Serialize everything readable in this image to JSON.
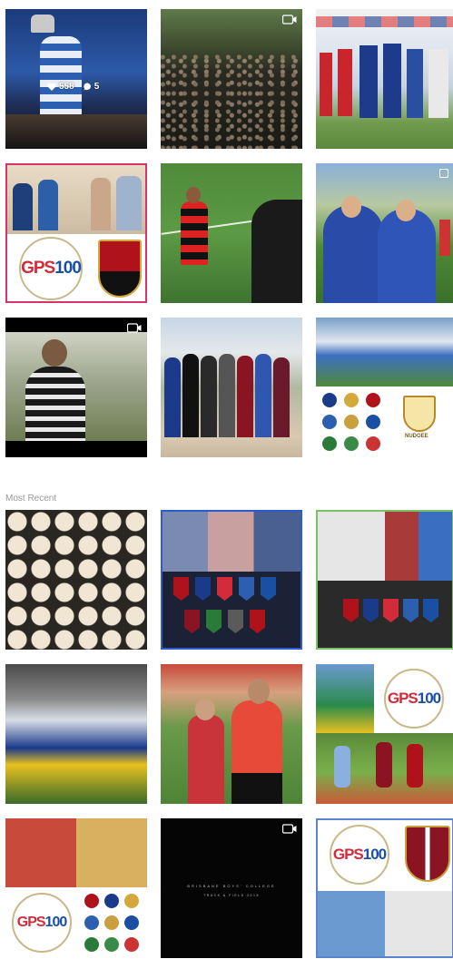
{
  "top_posts": [
    {
      "video": false,
      "stats": {
        "likes": "558",
        "comments": "5"
      }
    },
    {
      "video": true
    },
    {
      "video": false
    },
    {
      "video": false,
      "gps_text": "GPS100"
    },
    {
      "video": false
    },
    {
      "video": false
    },
    {
      "video": true
    },
    {
      "video": false
    },
    {
      "video": false,
      "nudgee_text": "NUDGEE"
    }
  ],
  "section": {
    "most_recent_label": "Most Recent"
  },
  "recent_posts": [
    {
      "video": false
    },
    {
      "video": false
    },
    {
      "video": false
    },
    {
      "video": false
    },
    {
      "video": false
    },
    {
      "video": false,
      "gps_text": "GPS100"
    },
    {
      "video": false,
      "gps_text": "GPS100"
    },
    {
      "video": true,
      "caption_line1": "BRISBANE BOYS' COLLEGE",
      "caption_line2": "TRACK & FIELD 2018"
    },
    {
      "video": false,
      "gps_text": "GPS100"
    }
  ],
  "icons": {
    "video": "video-camera-icon",
    "heart": "heart-icon",
    "comment": "comment-icon"
  },
  "colors": {
    "gps_red": "#d42b3a",
    "gps_blue": "#1a4fa3",
    "label_gray": "#999999"
  }
}
